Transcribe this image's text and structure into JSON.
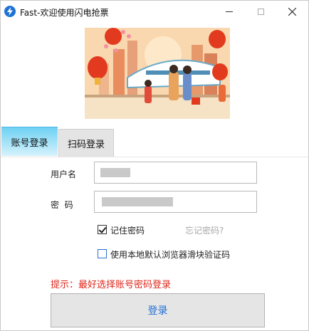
{
  "window": {
    "title": "Fast-欢迎使用闪电抢票",
    "icon": "lightning-icon",
    "controls": [
      "minimize-icon",
      "maximize-icon",
      "close-icon"
    ]
  },
  "tabs": [
    {
      "label": "账号登录",
      "active": true
    },
    {
      "label": "扫码登录",
      "active": false
    }
  ],
  "form": {
    "username_label": "用户名",
    "password_label": "密  码",
    "remember_label": "记住密码",
    "remember_checked": true,
    "forgot_label": "忘记密码?",
    "browser_verify_label": "使用本地默认浏览器滑块验证码",
    "browser_verify_checked": false
  },
  "hint": "提示：最好选择账号密码登录",
  "login_button": "登录",
  "colors": {
    "accent": "#1f6fd6",
    "tab_active": "#6fd1f4",
    "hint": "#e0261a"
  }
}
